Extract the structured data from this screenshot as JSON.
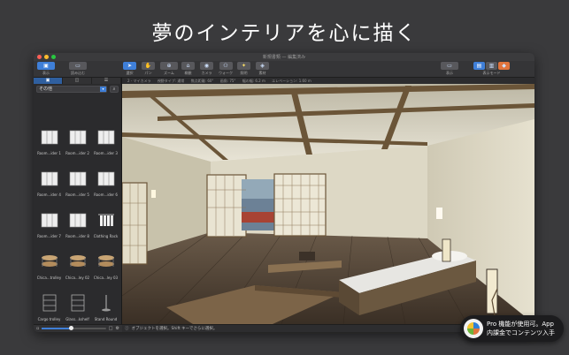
{
  "headline": "夢のインテリアを心に描く",
  "window": {
    "title": "新規書類 — 編集済み",
    "traffic_colors": [
      "#ff5f57",
      "#febc2e",
      "#28c840"
    ]
  },
  "toolbar": {
    "left": [
      {
        "label": "表示",
        "icon": "display-icon"
      },
      {
        "label": "読み込む",
        "icon": "import-icon"
      }
    ],
    "center": [
      {
        "label": "選択",
        "icon": "select-icon"
      },
      {
        "label": "パン",
        "icon": "pan-icon"
      },
      {
        "label": "ズーム",
        "icon": "zoom-icon"
      },
      {
        "label": "概観",
        "icon": "overview-icon"
      },
      {
        "label": "カメラ",
        "icon": "camera-icon"
      },
      {
        "label": "ウォーク",
        "icon": "walk-icon"
      },
      {
        "label": "照明",
        "icon": "light-icon"
      },
      {
        "label": "素材",
        "icon": "material-icon"
      }
    ],
    "right": [
      {
        "label": "表示",
        "icon": "view-mode-icon"
      },
      {
        "label": "表示モード",
        "icon": "display-mode-icon"
      }
    ]
  },
  "pathbar": [
    "2 - マイカメラ",
    "視野タイプ: 通常",
    "焦点距離: 60°",
    "画角: 75°",
    "幅の幅: 6.2 m",
    "エレベーション: 1.60 m"
  ],
  "sidebar": {
    "tabs": [
      "▣",
      "◫",
      "☰"
    ],
    "category": "その他",
    "items": [
      {
        "label": "Room...ider 1",
        "kind": "divider"
      },
      {
        "label": "Room...ider 2",
        "kind": "divider"
      },
      {
        "label": "Room...ider 3",
        "kind": "divider"
      },
      {
        "label": "Room...ider 4",
        "kind": "divider"
      },
      {
        "label": "Room...ider 5",
        "kind": "divider"
      },
      {
        "label": "Room...ider 6",
        "kind": "divider"
      },
      {
        "label": "Room...ider 7",
        "kind": "divider"
      },
      {
        "label": "Room...ider 8",
        "kind": "divider"
      },
      {
        "label": "Clothing Rack",
        "kind": "rack"
      },
      {
        "label": "Chica...trolley",
        "kind": "trolley"
      },
      {
        "label": "Chica...ley 02",
        "kind": "trolley"
      },
      {
        "label": "Chica...ley 03",
        "kind": "trolley"
      },
      {
        "label": "Cargo trolley",
        "kind": "shelf"
      },
      {
        "label": "Glass...kshelf",
        "kind": "shelf"
      },
      {
        "label": "Stand Round",
        "kind": "stand"
      }
    ],
    "zoom": 0.45
  },
  "statusbar": {
    "text": "オブジェクトを選択。Shift キーでさらに選択。"
  },
  "promo": {
    "line1": "Pro 機能が使用可。App",
    "line2": "内課金でコンテンツ入手"
  }
}
